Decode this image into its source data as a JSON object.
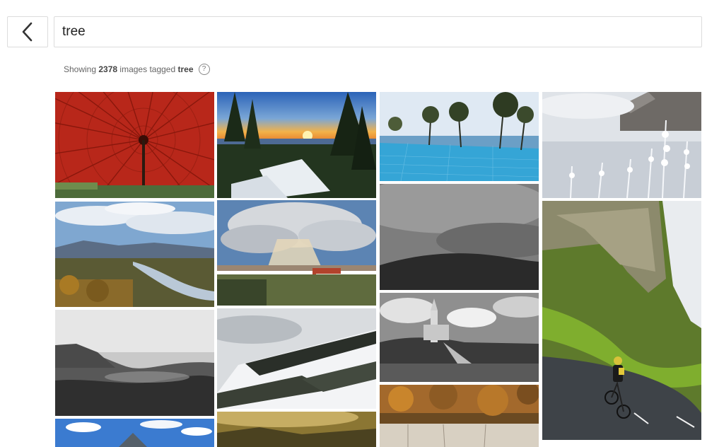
{
  "search": {
    "query": "tree",
    "back_icon": "chevron-left-icon"
  },
  "summary": {
    "prefix": "Showing",
    "count": "2378",
    "middle": "images tagged",
    "tag": "tree",
    "help_glyph": "?"
  },
  "gallery": {
    "columns": [
      {
        "tiles": [
          {
            "subject": "red-paper-umbrella"
          },
          {
            "subject": "lake-valley-autumn"
          },
          {
            "subject": "foggy-forest-hills"
          },
          {
            "subject": "blue-sky-mountains"
          }
        ]
      },
      {
        "tiles": [
          {
            "subject": "sunset-pine-trees"
          },
          {
            "subject": "storm-cloud-house"
          },
          {
            "subject": "snowy-slope-fog"
          },
          {
            "subject": "golden-hazy-valley"
          }
        ]
      },
      {
        "tiles": [
          {
            "subject": "infinity-pool-trees"
          },
          {
            "subject": "dark-hill-overcast"
          },
          {
            "subject": "lake-bled-church"
          },
          {
            "subject": "autumn-waterfall"
          }
        ]
      },
      {
        "tiles": [
          {
            "subject": "frosted-plants"
          },
          {
            "subject": "cyclist-cliff-road"
          }
        ]
      }
    ]
  }
}
